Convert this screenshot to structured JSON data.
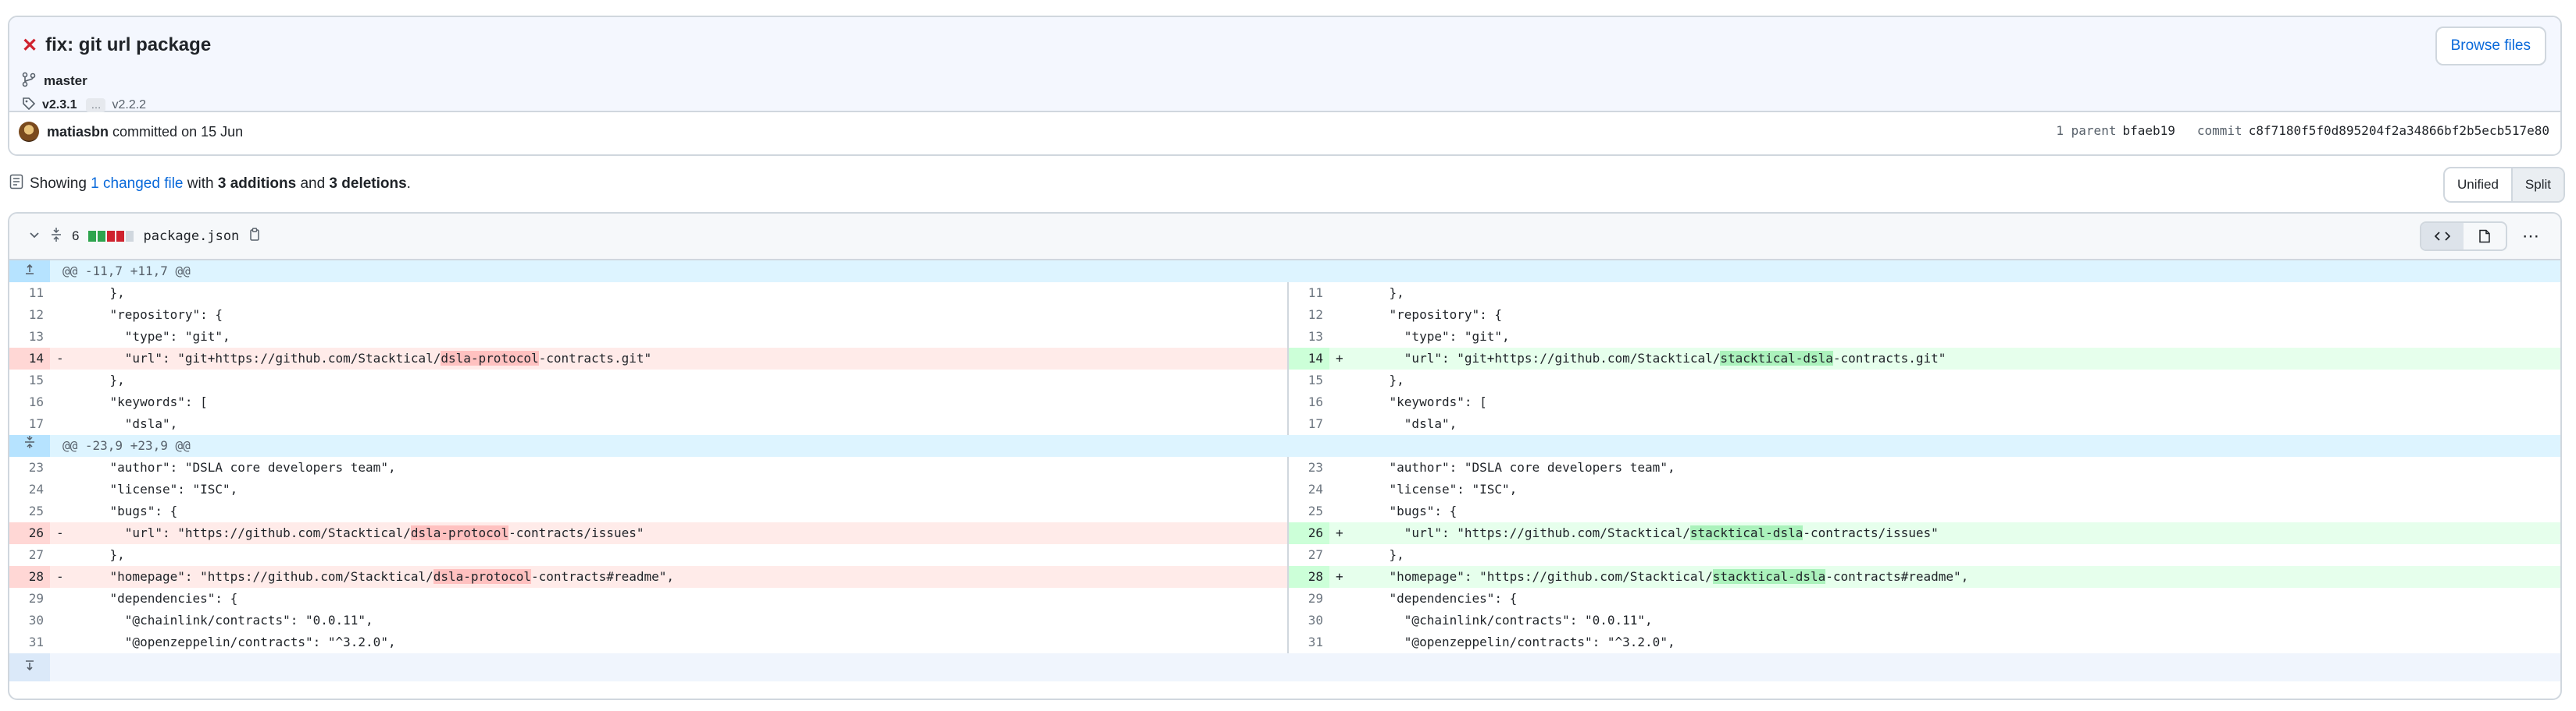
{
  "commit": {
    "status_icon": "x-icon",
    "title": "fix: git url package",
    "browse_label": "Browse files",
    "branch": "master",
    "tag_main": "v2.3.1",
    "tag_ellipsis": "…",
    "tag_other": "v2.2.2",
    "author": "matiasbn",
    "committed_text": "committed on 15 Jun",
    "parent_label": "1 parent",
    "parent_sha": "bfaeb19",
    "commit_label": "commit",
    "commit_sha": "c8f7180f5f0d895204f2a34866bf2b5ecb517e80"
  },
  "summary": {
    "prefix": "Showing",
    "changed": "1 changed file",
    "with": "with",
    "additions": "3 additions",
    "and": "and",
    "deletions": "3 deletions",
    "period": "."
  },
  "view_toggle": {
    "unified": "Unified",
    "split": "Split",
    "selected": "Split"
  },
  "file": {
    "change_count": "6",
    "filename": "package.json",
    "colors": {
      "add": "#2da44e",
      "del": "#cf222e",
      "neutral": "#d0d7de"
    }
  },
  "hunks": [
    {
      "header": "@@ -11,7 +11,7 @@"
    },
    {
      "header": "@@ -23,9 +23,9 @@"
    }
  ],
  "left": [
    {
      "n": "11",
      "code": "    },"
    },
    {
      "n": "12",
      "code": "    \"repository\": {"
    },
    {
      "n": "13",
      "code": "      \"type\": \"git\","
    },
    {
      "n": "14",
      "sign": "-",
      "pre": "      \"url\": \"git+https://github.com/Stacktical/",
      "hl": "dsla-protocol",
      "post": "-contracts.git\""
    },
    {
      "n": "15",
      "code": "    },"
    },
    {
      "n": "16",
      "code": "    \"keywords\": ["
    },
    {
      "n": "17",
      "code": "      \"dsla\","
    },
    {
      "n": "23",
      "code": "    \"author\": \"DSLA core developers team\","
    },
    {
      "n": "24",
      "code": "    \"license\": \"ISC\","
    },
    {
      "n": "25",
      "code": "    \"bugs\": {"
    },
    {
      "n": "26",
      "sign": "-",
      "pre": "      \"url\": \"https://github.com/Stacktical/",
      "hl": "dsla-protocol",
      "post": "-contracts/issues\""
    },
    {
      "n": "27",
      "code": "    },"
    },
    {
      "n": "28",
      "sign": "-",
      "pre": "    \"homepage\": \"https://github.com/Stacktical/",
      "hl": "dsla-protocol",
      "post": "-contracts#readme\","
    },
    {
      "n": "29",
      "code": "    \"dependencies\": {"
    },
    {
      "n": "30",
      "code": "      \"@chainlink/contracts\": \"0.0.11\","
    },
    {
      "n": "31",
      "code": "      \"@openzeppelin/contracts\": \"^3.2.0\","
    }
  ],
  "right": [
    {
      "n": "11",
      "code": "    },"
    },
    {
      "n": "12",
      "code": "    \"repository\": {"
    },
    {
      "n": "13",
      "code": "      \"type\": \"git\","
    },
    {
      "n": "14",
      "sign": "+",
      "pre": "      \"url\": \"git+https://github.com/Stacktical/",
      "hl": "stacktical-dsla",
      "post": "-contracts.git\""
    },
    {
      "n": "15",
      "code": "    },"
    },
    {
      "n": "16",
      "code": "    \"keywords\": ["
    },
    {
      "n": "17",
      "code": "      \"dsla\","
    },
    {
      "n": "23",
      "code": "    \"author\": \"DSLA core developers team\","
    },
    {
      "n": "24",
      "code": "    \"license\": \"ISC\","
    },
    {
      "n": "25",
      "code": "    \"bugs\": {"
    },
    {
      "n": "26",
      "sign": "+",
      "pre": "      \"url\": \"https://github.com/Stacktical/",
      "hl": "stacktical-dsla",
      "post": "-contracts/issues\""
    },
    {
      "n": "27",
      "code": "    },"
    },
    {
      "n": "28",
      "sign": "+",
      "pre": "    \"homepage\": \"https://github.com/Stacktical/",
      "hl": "stacktical-dsla",
      "post": "-contracts#readme\","
    },
    {
      "n": "29",
      "code": "    \"dependencies\": {"
    },
    {
      "n": "30",
      "code": "      \"@chainlink/contracts\": \"0.0.11\","
    },
    {
      "n": "31",
      "code": "      \"@openzeppelin/contracts\": \"^3.2.0\","
    }
  ]
}
